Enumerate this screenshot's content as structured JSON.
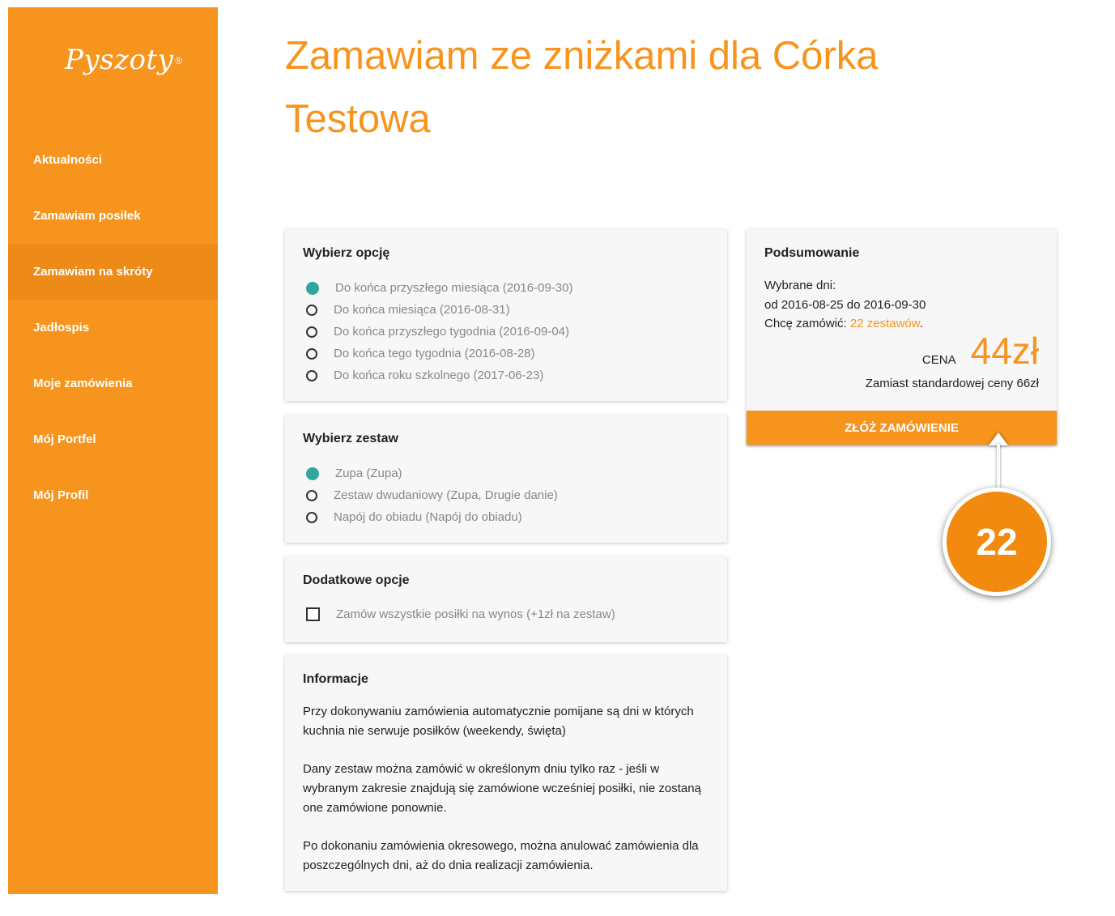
{
  "app": {
    "logo_text": "Pyszoty",
    "logo_mark": "®"
  },
  "sidebar": {
    "items": [
      {
        "label": "Aktualności"
      },
      {
        "label": "Zamawiam posiłek"
      },
      {
        "label": "Zamawiam na skróty",
        "active": true
      },
      {
        "label": "Jadłospis"
      },
      {
        "label": "Moje zamówienia"
      },
      {
        "label": "Mój Portfel"
      },
      {
        "label": "Mój Profil"
      }
    ]
  },
  "page": {
    "title_line1": "Zamawiam ze zniżkami dla Córka",
    "title_line2": "Testowa"
  },
  "options": {
    "title": "Wybierz opcję",
    "items": [
      {
        "label": "Do końca przyszłego miesiąca (2016-09-30)",
        "checked": true
      },
      {
        "label": "Do końca miesiąca (2016-08-31)",
        "checked": false
      },
      {
        "label": "Do końca przyszłego tygodnia (2016-09-04)",
        "checked": false
      },
      {
        "label": "Do końca tego tygodnia (2016-08-28)",
        "checked": false
      },
      {
        "label": "Do końca roku szkolnego (2017-06-23)",
        "checked": false
      }
    ]
  },
  "sets": {
    "title": "Wybierz zestaw",
    "items": [
      {
        "label": "Zupa (Zupa)",
        "checked": true
      },
      {
        "label": "Zestaw dwudaniowy (Zupa, Drugie danie)",
        "checked": false
      },
      {
        "label": "Napój do obiadu (Napój do obiadu)",
        "checked": false
      }
    ]
  },
  "extras": {
    "title": "Dodatkowe opcje",
    "takeaway_label": "Zamów wszystkie posiłki na wynos (+1zł na zestaw)",
    "takeaway_checked": false
  },
  "info": {
    "title": "Informacje",
    "paragraphs": [
      "Przy dokonywaniu zamówienia automatycznie pomijane są dni w których kuchnia nie serwuje posiłków (weekendy, święta)",
      "Dany zestaw można zamówić w określonym dniu tylko raz - jeśli w wybranym zakresie znajdują się zamówione wcześniej posiłki, nie zostaną one zamówione ponownie.",
      "Po dokonaniu zamówienia okresowego, można anulować zamówienia dla poszczególnych dni, aż do dnia realizacji zamówienia."
    ]
  },
  "summary": {
    "title": "Podsumowanie",
    "days_label": "Wybrane dni:",
    "range": "od 2016-08-25 do 2016-09-30",
    "want_prefix": "Chcę zamówić: ",
    "want_count": "22 zestawów",
    "want_suffix": ".",
    "price_label": "CENA",
    "price": "44zł",
    "instead": "Zamiast standardowej ceny 66zł",
    "button": "ZŁÓŻ ZAMÓWIENIE"
  },
  "callout": {
    "number": "22"
  },
  "colors": {
    "accent": "#f7941d",
    "radio_checked": "#2ea89e",
    "active_nav": "#ed8a18"
  }
}
